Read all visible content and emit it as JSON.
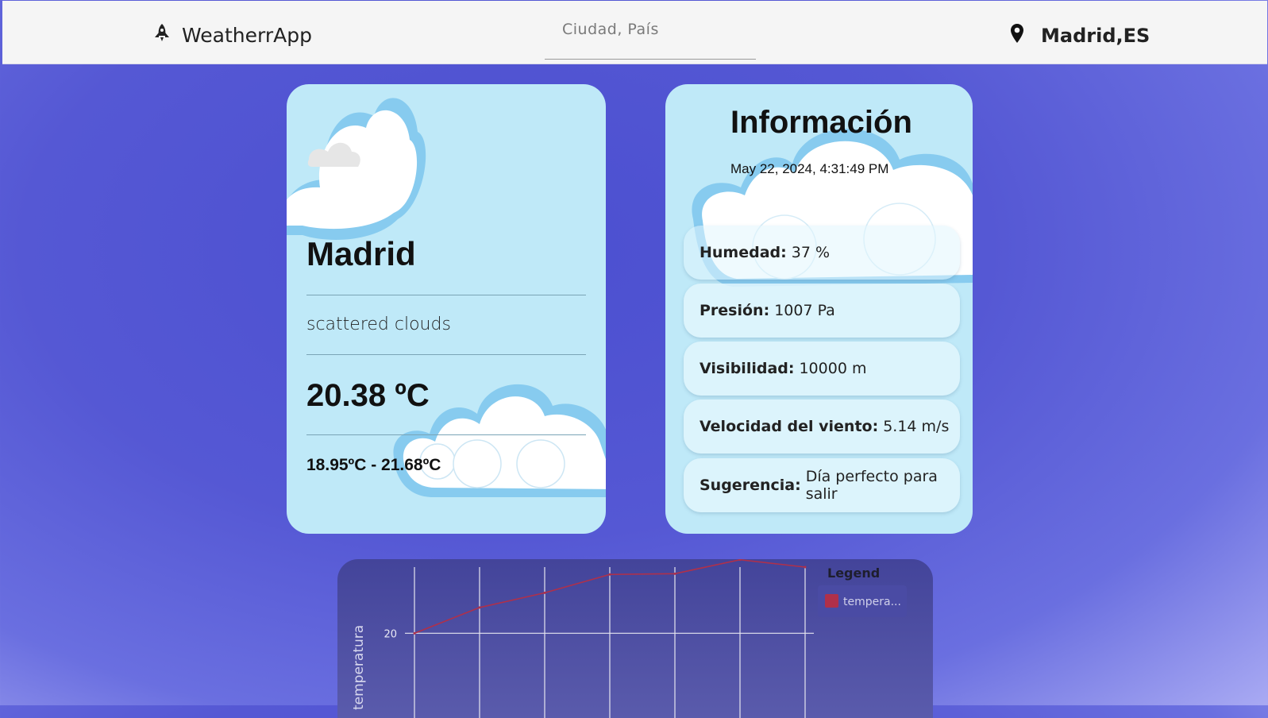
{
  "app": {
    "name": "WeatherrApp",
    "logo_icon": "rocket-icon"
  },
  "search": {
    "placeholder": "Ciudad, País",
    "value": ""
  },
  "location": {
    "icon": "map-pin-icon",
    "label": "Madrid,ES"
  },
  "weather_card": {
    "city": "Madrid",
    "description": "scattered clouds",
    "temperature": "20.38 ºC",
    "range": "18.95ºC - 21.68ºC"
  },
  "info_card": {
    "title": "Información",
    "datetime": "May 22, 2024, 4:31:49 PM",
    "rows": [
      {
        "label": "Humedad:",
        "value": "37 %"
      },
      {
        "label": "Presión:",
        "value": "1007 Pa"
      },
      {
        "label": "Visibilidad:",
        "value": "10000 m"
      },
      {
        "label": "Velocidad del viento:",
        "value": "5.14 m/s"
      },
      {
        "label": "Sugerencia:",
        "value": "Día perfecto para salir"
      }
    ]
  },
  "chart_data": {
    "type": "line",
    "title": "",
    "ylabel": "temperatura",
    "xlabel": "",
    "y_tick_labels": [
      "20"
    ],
    "y_ticks": [
      20
    ],
    "ylim": [
      16.4,
      21.8
    ],
    "x": [
      0,
      1,
      2,
      3,
      4,
      5,
      6
    ],
    "series": [
      {
        "name": "tempera...",
        "values": [
          20.0,
          20.7,
          21.1,
          21.6,
          21.62,
          22.0,
          21.8
        ]
      }
    ],
    "legend": {
      "title": "Legend",
      "position": "top-right"
    },
    "grid": true,
    "colors": {
      "line": "#b0304a",
      "grid": "#e6e6f0"
    }
  }
}
